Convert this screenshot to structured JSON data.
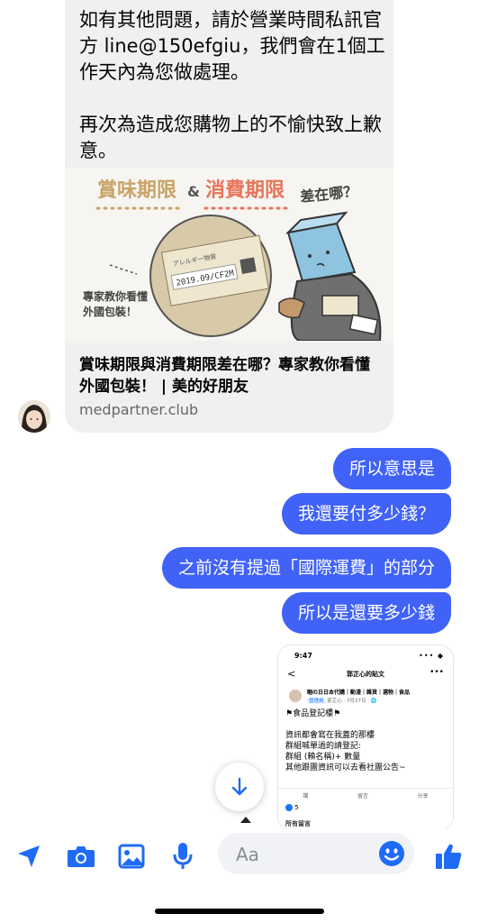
{
  "incoming": {
    "text": "如有其他問題，請於營業時間私訊官方 line@150efgiu，我們會在1個工作天內為您做處理。\n\n再次為造成您購物上的不愉快致上歉意。",
    "link_image": {
      "word1": "賞味期限",
      "amp": "&",
      "word2": "消費期限",
      "question": "差在哪？",
      "side_note_line1": "專家教你看懂",
      "side_note_line2": "外國包裝！",
      "label_date": "2019.09/CF2M",
      "label_top": "アレルギー物質"
    },
    "link_title": "賞味期限與消費期限差在哪？專家教你看懂外國包裝！ | 美的好朋友",
    "link_domain": "medpartner.club"
  },
  "outgoing": [
    "所以意思是",
    "我還要付多少錢？",
    "之前沒有提過「國際運費」的部分",
    "所以是還要多少錢"
  ],
  "screenshot": {
    "status_time": "9:47",
    "status_right": "••• ◆",
    "back": "<",
    "nav_title": "郭芷心的貼文",
    "more": "•••",
    "group_name": "睏の日日本代購｜動漫｜雜貨｜選物｜食品",
    "role": "管理員",
    "meta": "郭芷心 · 7月27日 · 🌐",
    "body": "⚑食品登記樓⚑\n\n資訊都會寫在我蓋的那樓\n群組喊單過的請登記:\n群組 (賴名稱)+ 數量\n其他跟團資訊可以去看社團公告~",
    "actions": [
      "讚",
      "留言",
      "分享"
    ],
    "likes": "5",
    "footer": "所有留言"
  },
  "composer": {
    "placeholder": "Aa"
  },
  "colors": {
    "accent": "#4062f7",
    "messenger_blue": "#1f6bf5",
    "incoming_bg": "#f0f0f0"
  },
  "icons": [
    "location-arrow-icon",
    "camera-icon",
    "image-icon",
    "microphone-icon",
    "emoji-icon",
    "thumbs-up-icon",
    "arrow-down-icon"
  ]
}
